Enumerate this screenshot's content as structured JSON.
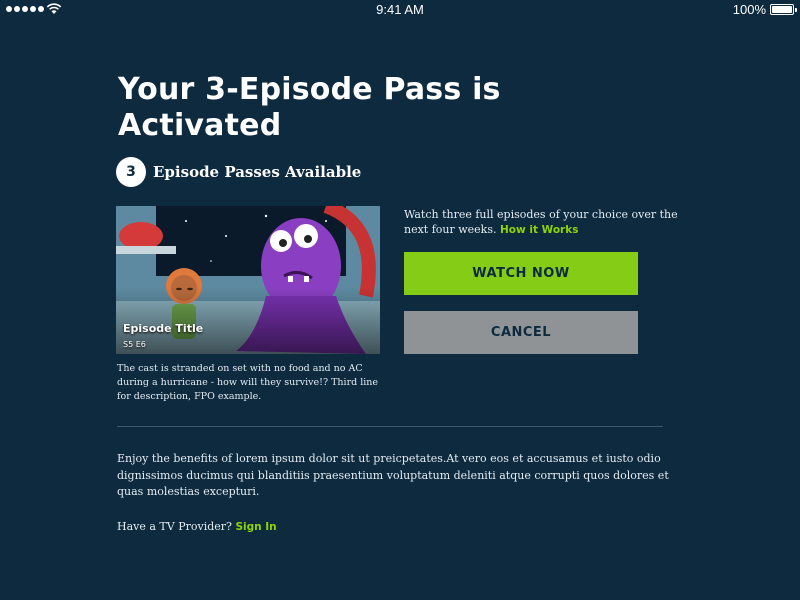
{
  "status_bar": {
    "time": "9:41 AM",
    "battery": "100%",
    "icons": [
      "signal-dots-icon",
      "wifi-icon",
      "battery-icon"
    ]
  },
  "heading": {
    "title": "Your 3-Episode Pass is Activated"
  },
  "passes": {
    "count": "3",
    "label": "Episode Passes Available"
  },
  "episode": {
    "title": "Episode Title",
    "number": "S5 E6",
    "description": "The cast is stranded on set with no food and no AC during a hurricane - how will they survive!? Third line for description, FPO example."
  },
  "offer": {
    "text": "Watch three full episodes of your choice over the next four weeks.",
    "link": "How it Works"
  },
  "buttons": {
    "watch": "WATCH NOW",
    "cancel": "CANCEL"
  },
  "body": {
    "text": "Enjoy the benefits of lorem ipsum dolor sit ut preicpetates.At vero eos et accusamus et iusto odio dignissimos ducimus qui blanditiis praesentium voluptatum deleniti atque corrupti quos dolores et quas molestias excepturi."
  },
  "provider": {
    "prompt": "Have a TV Provider?",
    "link": "Sign In"
  },
  "colors": {
    "background": "#0e2a3f",
    "accent": "#84cc16",
    "cancel": "#8f9396"
  }
}
